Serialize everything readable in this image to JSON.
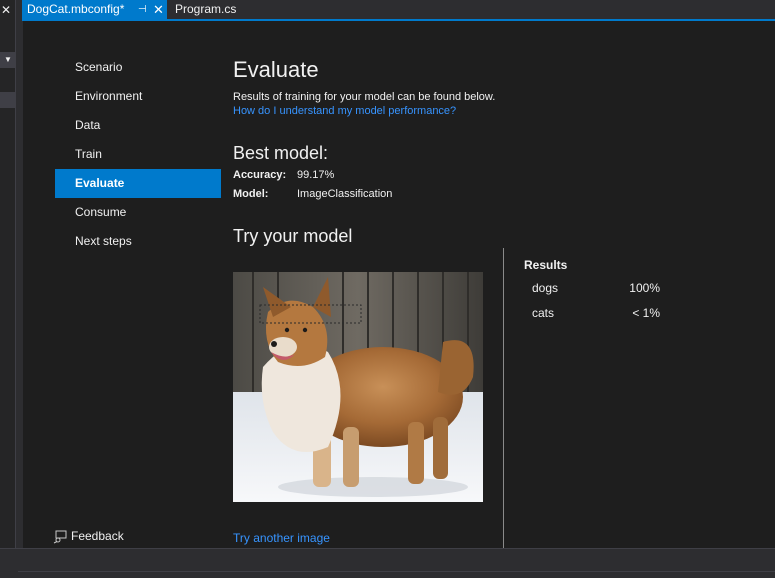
{
  "tabs": [
    {
      "label": "DogCat.mbconfig*",
      "active": true
    },
    {
      "label": "Program.cs",
      "active": false
    }
  ],
  "nav": {
    "items": [
      {
        "label": "Scenario"
      },
      {
        "label": "Environment"
      },
      {
        "label": "Data"
      },
      {
        "label": "Train"
      },
      {
        "label": "Evaluate",
        "active": true
      },
      {
        "label": "Consume"
      },
      {
        "label": "Next steps"
      }
    ],
    "feedback_label": "Feedback"
  },
  "page": {
    "title": "Evaluate",
    "subtitle": "Results of training for your model can be found below.",
    "help_link": "How do I understand my model performance?"
  },
  "best_model": {
    "heading": "Best model:",
    "accuracy_label": "Accuracy:",
    "accuracy_value": "99.17%",
    "model_label": "Model:",
    "model_value": "ImageClassification"
  },
  "try_model": {
    "heading": "Try your model",
    "try_another_label": "Try another image"
  },
  "results": {
    "title": "Results",
    "rows": [
      {
        "label": "dogs",
        "value": "100%"
      },
      {
        "label": "cats",
        "value": "< 1%"
      }
    ]
  },
  "colors": {
    "accent": "#007acc",
    "link": "#3794ff",
    "background": "#1e1e1e"
  }
}
